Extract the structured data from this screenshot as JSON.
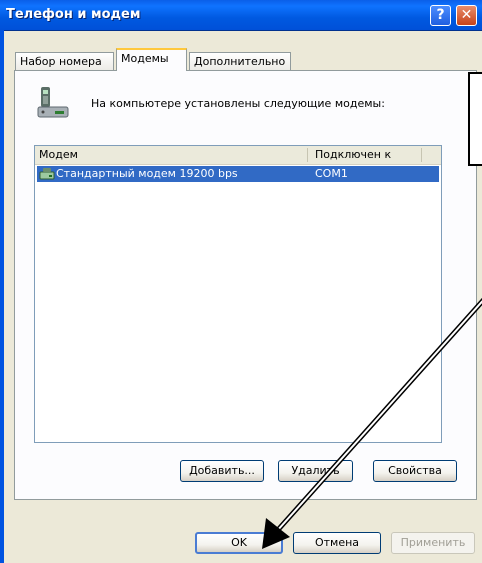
{
  "window": {
    "title": "Телефон и модем"
  },
  "titlebar": {
    "help_glyph": "?",
    "close_glyph": "✕"
  },
  "tabs": [
    {
      "label": "Набор номера",
      "active": false
    },
    {
      "label": "Модемы",
      "active": true
    },
    {
      "label": "Дополнительно",
      "active": false
    }
  ],
  "panel": {
    "info_text": "На компьютере установлены следующие модемы:"
  },
  "list": {
    "columns": [
      "Модем",
      "Подключен к"
    ],
    "rows": [
      {
        "name": "Стандартный модем 19200 bps",
        "port": "COM1",
        "selected": true
      }
    ]
  },
  "panel_buttons": {
    "add": "Добавить...",
    "remove": "Удалить",
    "properties": "Свойства"
  },
  "dialog_buttons": {
    "ok": "OK",
    "cancel": "Отмена",
    "apply": "Применить"
  },
  "colors": {
    "selection": "#316AC5",
    "titlebar": "#0A5FE8",
    "face": "#ECE9D8",
    "tab_highlight": "#FFC83C"
  }
}
